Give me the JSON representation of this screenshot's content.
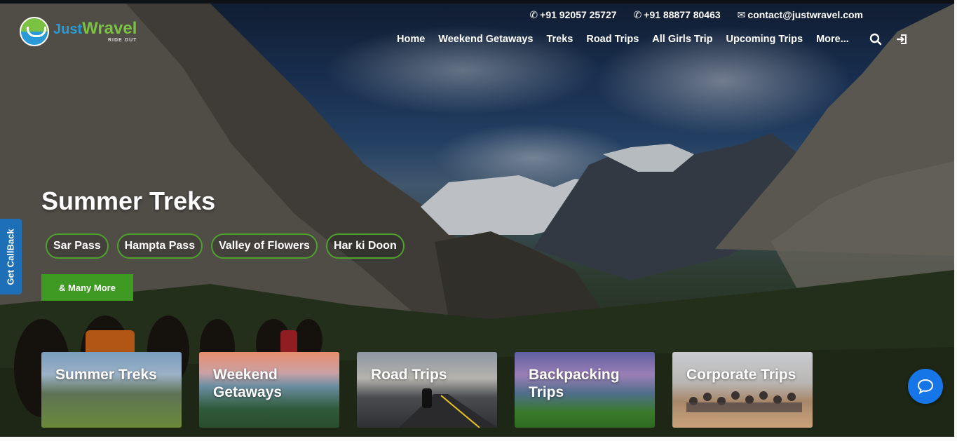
{
  "logo": {
    "just": "Just",
    "wravel": "Wravel",
    "tagline": "RIDE OUT"
  },
  "topbar": {
    "phone1": "+91 92057 25727",
    "phone2": "+91 88877 80463",
    "email": "contact@justwravel.com"
  },
  "nav": {
    "items": [
      "Home",
      "Weekend Getaways",
      "Treks",
      "Road Trips",
      "All Girls Trip",
      "Upcoming Trips",
      "More..."
    ]
  },
  "hero": {
    "title": "Summer Treks",
    "pills": [
      "Sar Pass",
      "Hampta Pass",
      "Valley of Flowers",
      "Har ki Doon"
    ],
    "more_label": "& Many More"
  },
  "callback": {
    "label": "Get CallBack"
  },
  "cards": [
    "Summer Treks",
    "Weekend Getaways",
    "Road Trips",
    "Backpacking Trips",
    "Corporate Trips"
  ],
  "colors": {
    "accent_green": "#3f9a23",
    "callback_blue": "#1d70b8",
    "chat_blue": "#1676e8"
  },
  "icons": [
    "phone-icon",
    "mail-icon",
    "search-icon",
    "login-icon",
    "chat-icon"
  ]
}
